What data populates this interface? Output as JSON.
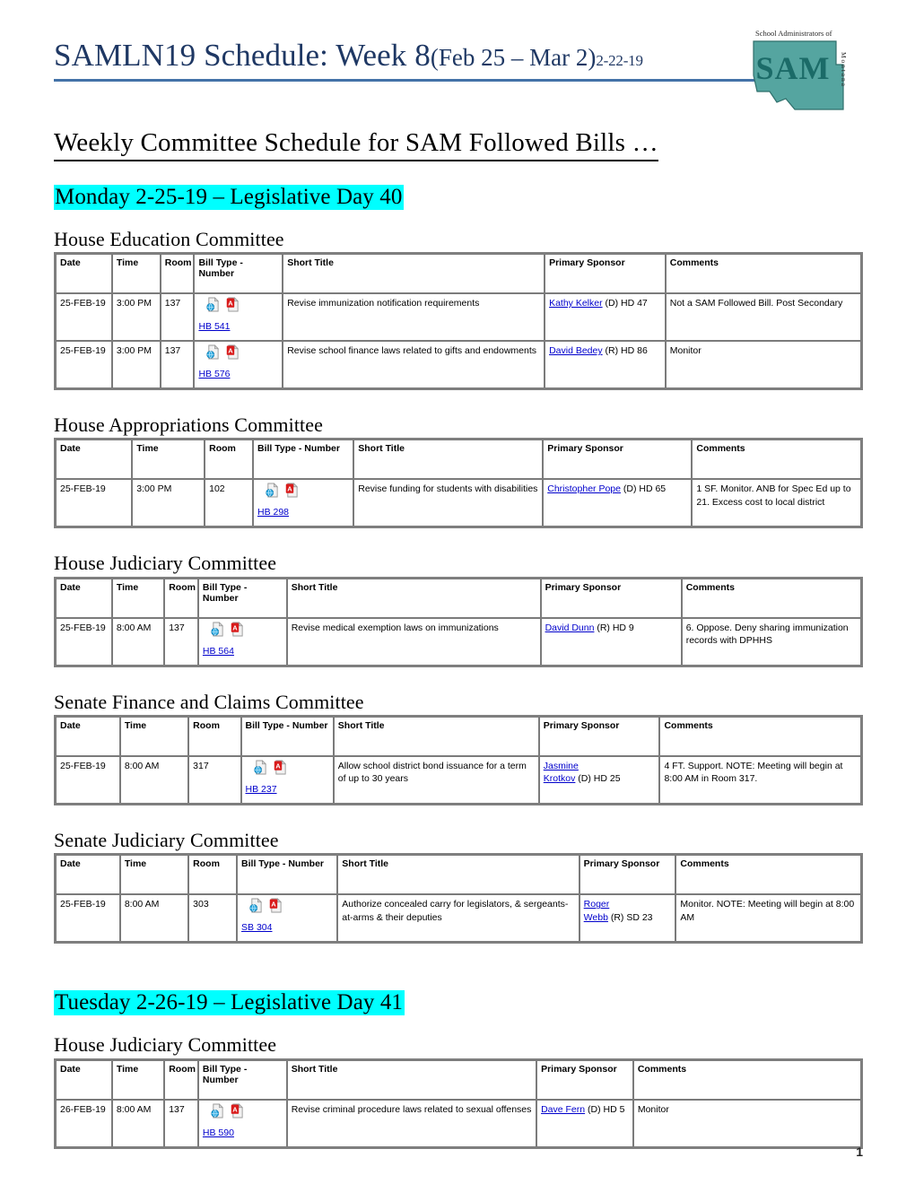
{
  "header": {
    "title_main": "SAMLN19 Schedule: Week 8",
    "title_paren": "(Feb 25 – Mar 2)",
    "title_date": "2-22-19",
    "logo_alt": "School Administrators of Montana",
    "logo_top_text": "School Administrators of",
    "logo_word": "SAM",
    "logo_side_text": "Montana",
    "logo_color": "#4A9E9E",
    "title_color": "#1F3864",
    "rule_color": "#4472A8"
  },
  "subtitle": "Weekly Committee Schedule for SAM Followed Bills …",
  "highlight_color": "#00FFFF",
  "link_color": "#0000CC",
  "columns": [
    "Date",
    "Time",
    "Room",
    "Bill Type - Number",
    "Short Title",
    "Primary Sponsor",
    "Comments"
  ],
  "icons": {
    "web": "web-page-icon",
    "pdf": "pdf-document-icon"
  },
  "page_number": "1",
  "days": [
    {
      "label": "Monday 2-25-19 – Legislative Day 40",
      "committees": [
        {
          "name": "House Education Committee",
          "widths": [
            "7.0%",
            "6.0%",
            "4.2%",
            "11.0%",
            "32.5%",
            "15.0%",
            "24.3%"
          ],
          "rows": [
            {
              "date": "25-FEB-19",
              "time": "3:00 PM",
              "room": "137",
              "bill": "HB 541",
              "title": "Revise immunization notification requirements",
              "sponsor_name": "Kathy Kelker",
              "sponsor_suffix": "(D) HD 47",
              "comments": "Not a SAM Followed Bill.  Post Secondary"
            },
            {
              "date": "25-FEB-19",
              "time": "3:00 PM",
              "room": "137",
              "bill": "HB 576",
              "title": "Revise school finance laws related to gifts and endowments",
              "sponsor_name": "David Bedey",
              "sponsor_suffix": "(R) HD 86",
              "comments": "Monitor"
            }
          ]
        },
        {
          "name": "House Appropriations Committee",
          "widths": [
            "9.5%",
            "9.0%",
            "6.0%",
            "12.5%",
            "23.5%",
            "18.5%",
            "21.0%"
          ],
          "rows": [
            {
              "date": "25-FEB-19",
              "time": "3:00 PM",
              "room": "102",
              "bill": "HB 298",
              "title": "Revise funding for students with disabilities",
              "sponsor_name": "Christopher Pope",
              "sponsor_suffix": "(D) HD 65",
              "comments": " 1 SF.  Monitor.  ANB for Spec Ed up to 21.  Excess cost to local district"
            }
          ]
        },
        {
          "name": "House Judiciary Committee",
          "widths": [
            "7.0%",
            "6.5%",
            "4.2%",
            "11.0%",
            "31.5%",
            "17.5%",
            "22.3%"
          ],
          "rows": [
            {
              "date": "25-FEB-19",
              "time": "8:00 AM",
              "room": "137",
              "bill": "HB 564",
              "title": "Revise medical exemption laws on immunizations",
              "sponsor_name": "David Dunn",
              "sponsor_suffix": "(R) HD 9",
              "comments": " 6.  Oppose.  Deny sharing immunization records with DPHHS"
            }
          ]
        },
        {
          "name": "Senate Finance and Claims Committee",
          "widths": [
            "8.0%",
            "8.5%",
            "6.5%",
            "11.5%",
            "25.5%",
            "15.0%",
            "25.0%"
          ],
          "rows": [
            {
              "date": "25-FEB-19",
              "time": "8:00 AM",
              "room": "317",
              "bill": "HB 237",
              "title": "Allow school district bond issuance for a term of up to 30 years",
              "sponsor_name": "Jasmine Krotkov",
              "sponsor_suffix": "(D) HD 25",
              "comments": "4 FT. Support.     NOTE: Meeting will begin at 8:00 AM in Room 317."
            }
          ]
        },
        {
          "name": "Senate Judiciary Committee",
          "widths": [
            "8.0%",
            "8.5%",
            "6.0%",
            "12.5%",
            "30.0%",
            "12.0%",
            "23.0%"
          ],
          "rows": [
            {
              "date": "25-FEB-19",
              "time": "8:00 AM",
              "room": "303",
              "bill": "SB 304",
              "title": "Authorize concealed carry for legislators, & sergeants-at-arms & their deputies",
              "sponsor_name": "Roger Webb",
              "sponsor_suffix": "(R) SD 23",
              "comments": "Monitor.  NOTE: Meeting will begin at 8:00 AM"
            }
          ]
        }
      ]
    },
    {
      "label": "Tuesday 2-26-19 – Legislative Day 41",
      "committees": [
        {
          "name": "House Judiciary Committee",
          "widths": [
            "7.0%",
            "6.5%",
            "4.2%",
            "11.0%",
            "31.0%",
            "12.0%",
            "28.3%"
          ],
          "rows": [
            {
              "date": "26-FEB-19",
              "time": "8:00 AM",
              "room": "137",
              "bill": "HB 590",
              "title": "Revise criminal procedure laws related to sexual offenses",
              "sponsor_name": "Dave Fern",
              "sponsor_suffix": "(D) HD 5",
              "comments": "Monitor"
            }
          ]
        }
      ]
    }
  ]
}
